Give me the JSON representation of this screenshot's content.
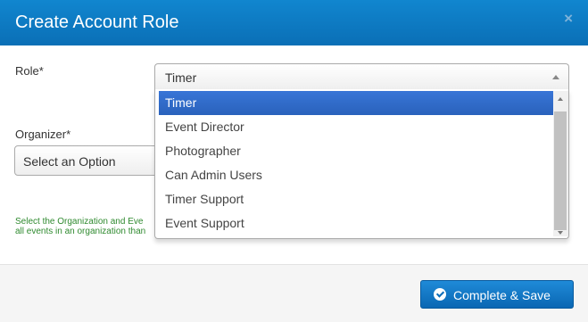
{
  "dialog": {
    "title": "Create Account Role",
    "close_icon": "×"
  },
  "form": {
    "role_label": "Role*",
    "role_value": "Timer",
    "organizer_label": "Organizer*",
    "organizer_value": "Select an Option",
    "hint_line1": "Select the Organization and Eve",
    "hint_line2": "all events in an organization than"
  },
  "dropdown": {
    "options": [
      "Timer",
      "Event Director",
      "Photographer",
      "Can Admin Users",
      "Timer Support",
      "Event Support"
    ],
    "selected": "Timer"
  },
  "footer": {
    "submit_label": "Complete & Save"
  },
  "colors": {
    "header": "#0a6fb6",
    "selected_option": "#3875d7",
    "hint_text": "#2f8a2f",
    "button": "#0a67b3"
  }
}
